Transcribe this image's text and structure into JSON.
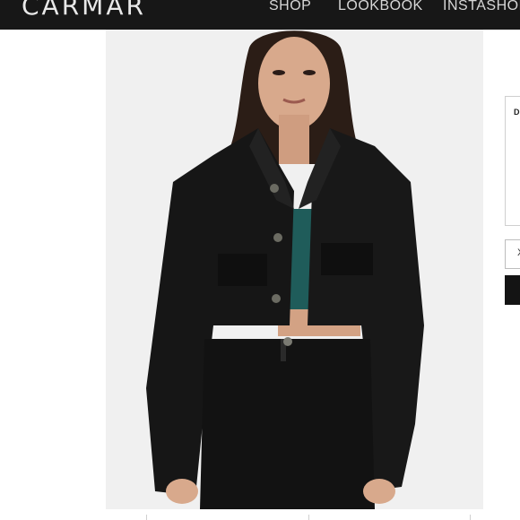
{
  "header": {
    "logo": "CARMAR",
    "nav": [
      "SHOP",
      "LOOKBOOK",
      "INSTASHOP"
    ]
  },
  "product_image": {
    "subject": "model-in-black-cropped-distressed-denim-jacket",
    "colors": {
      "background": "#f0f0f0",
      "jacket": "#161616",
      "top": "#1f5c5a",
      "skin": "#d8a98c",
      "hair": "#2b1d16"
    }
  },
  "side_panel": {
    "label": "D",
    "select_value": "X"
  },
  "colors": {
    "topbar": "#171717",
    "button": "#141414"
  }
}
